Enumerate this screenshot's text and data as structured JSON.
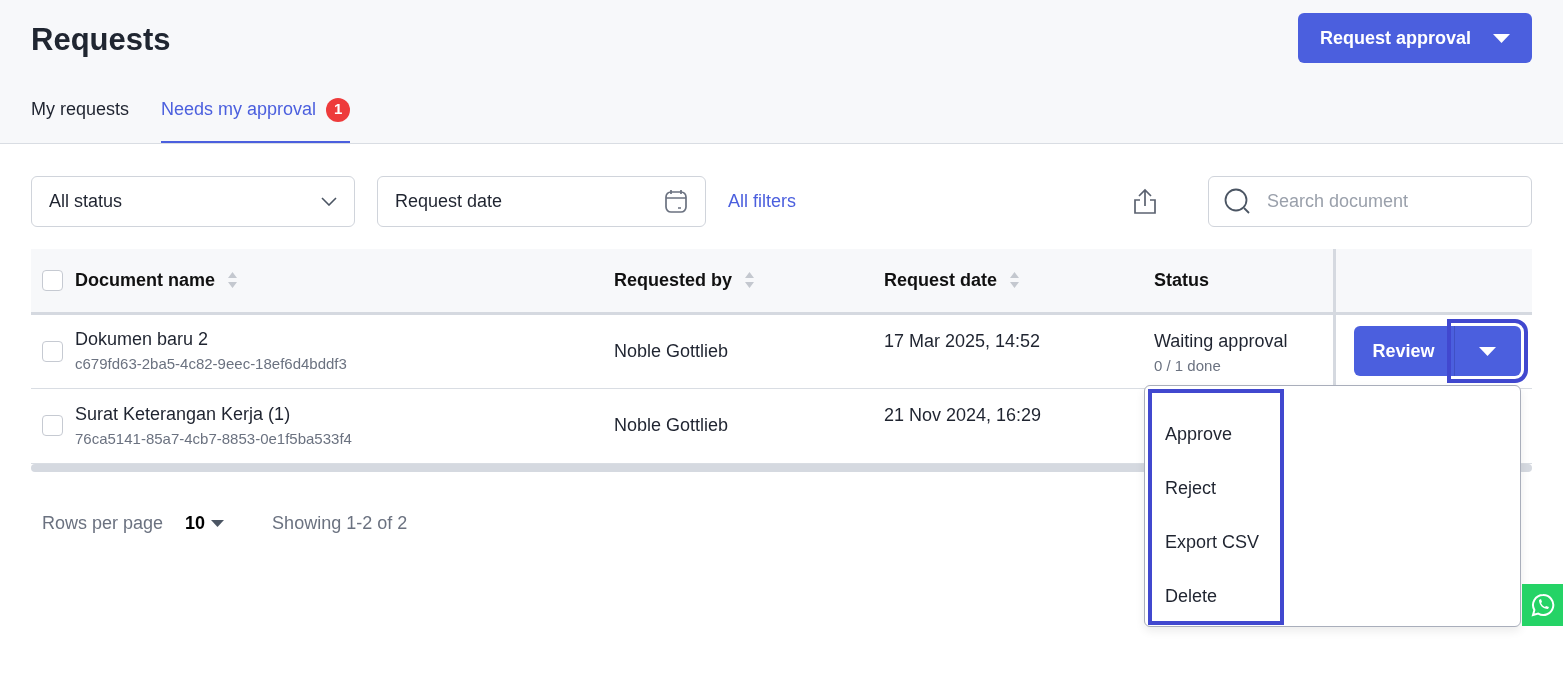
{
  "page": {
    "title": "Requests"
  },
  "primary_button": {
    "label": "Request approval"
  },
  "tabs": [
    {
      "label": "My requests",
      "selected": false
    },
    {
      "label": "Needs my approval",
      "selected": true,
      "badge": "1"
    }
  ],
  "filters": {
    "status": "All status",
    "date_placeholder": "Request date",
    "all_filters": "All filters",
    "search_placeholder": "Search document"
  },
  "table": {
    "select_all_checked": false,
    "columns": [
      {
        "label": "Document name",
        "sortable": true
      },
      {
        "label": "Requested by",
        "sortable": true
      },
      {
        "label": "Request date",
        "sortable": true
      },
      {
        "label": "Status",
        "sortable": false
      }
    ],
    "rows": [
      {
        "checked": false,
        "name": "Dokumen baru 2",
        "doc_id": "c679fd63-2ba5-4c82-9eec-18ef6d4bddf3",
        "requested_by": "Noble Gottlieb",
        "request_date": "17 Mar 2025, 14:52",
        "status": "Waiting approval",
        "progress": "0 / 1 done",
        "action": "Review",
        "caret_highlighted": true
      },
      {
        "checked": false,
        "name": "Surat Keterangan Kerja (1)",
        "doc_id": "76ca5141-85a7-4cb7-8853-0e1f5ba533f4",
        "requested_by": "Noble Gottlieb",
        "request_date": "21 Nov 2024, 16:29"
      }
    ]
  },
  "menu": {
    "highlighted": true,
    "items": [
      "Approve",
      "Reject",
      "Export CSV",
      "Delete"
    ]
  },
  "pagination": {
    "rows_per_page_label": "Rows per page",
    "rows_per_page": "10",
    "showing": "Showing 1-2 of 2"
  }
}
